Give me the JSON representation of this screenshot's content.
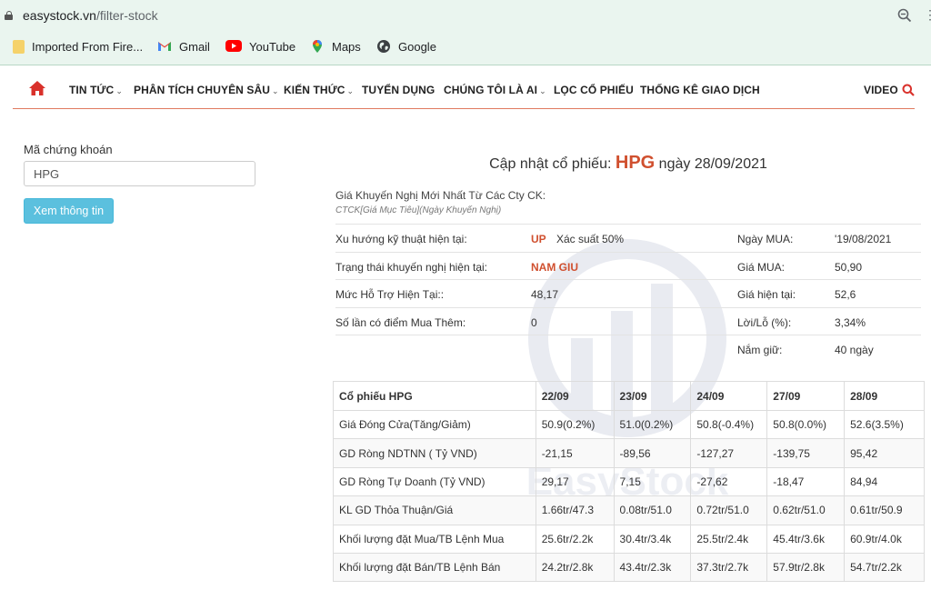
{
  "browser": {
    "url_host": "easystock.vn",
    "url_path": "/filter-stock",
    "bookmarks": [
      {
        "label": "Imported From Fire...",
        "icon": "folder-icon"
      },
      {
        "label": "Gmail",
        "icon": "gmail-icon"
      },
      {
        "label": "YouTube",
        "icon": "youtube-icon"
      },
      {
        "label": "Maps",
        "icon": "maps-icon"
      },
      {
        "label": "Google",
        "icon": "google-globe-icon"
      }
    ]
  },
  "nav": {
    "items": [
      {
        "label": "TIN TỨC",
        "dropdown": true
      },
      {
        "label": "PHÂN TÍCH CHUYÊN SÂU",
        "dropdown": true
      },
      {
        "label": "KIẾN THỨC",
        "dropdown": true
      },
      {
        "label": "TUYỂN DỤNG",
        "dropdown": false
      },
      {
        "label": "CHÚNG TÔI LÀ AI",
        "dropdown": true
      },
      {
        "label": "LỌC CỔ PHIẾU",
        "dropdown": false
      },
      {
        "label": "THỐNG KÊ GIAO DỊCH",
        "dropdown": false
      },
      {
        "label": "VIDEO",
        "dropdown": false
      }
    ],
    "chevron": "⌄"
  },
  "form": {
    "label": "Mã chứng khoán",
    "input_value": "HPG",
    "button_label": "Xem thông tin"
  },
  "title": {
    "prefix": "Cập nhật cổ phiếu:",
    "symbol": "HPG",
    "suffix": "ngày 28/09/2021"
  },
  "recommend": {
    "heading": "Giá Khuyến Nghị Mới Nhất Từ Các Cty CK:",
    "subheading": "CTCK[Giá Mục Tiêu](Ngày Khuyến Nghị)"
  },
  "info": {
    "rows": [
      {
        "label": "Xu hướng kỹ thuật hiện tại:",
        "value": "UP",
        "extra": "Xác suất 50%",
        "right_label": "Ngày MUA:",
        "right_value": "'19/08/2021"
      },
      {
        "label": "Trạng thái khuyến nghị hiện tại:",
        "value": "NAM GIU",
        "extra": "",
        "right_label": "Giá MUA:",
        "right_value": "50,90"
      },
      {
        "label": "Mức Hỗ Trợ Hiện Tại::",
        "value": "48,17",
        "extra": "",
        "right_label": "Giá hiện tại:",
        "right_value": "52,6"
      },
      {
        "label": "Số lần có điểm Mua Thêm:",
        "value": "0",
        "extra": "",
        "right_label": "Lời/Lỗ (%):",
        "right_value": "3,34%"
      },
      {
        "label": "",
        "value": "",
        "extra": "",
        "right_label": "Nắm giữ:",
        "right_value": "40 ngày"
      }
    ]
  },
  "table": {
    "headers": [
      "Cổ phiếu HPG",
      "22/09",
      "23/09",
      "24/09",
      "27/09",
      "28/09"
    ],
    "rows": [
      [
        "Giá Đóng Cửa(Tăng/Giảm)",
        "50.9(0.2%)",
        "51.0(0.2%)",
        "50.8(-0.4%)",
        "50.8(0.0%)",
        "52.6(3.5%)"
      ],
      [
        "GD Ròng NDTNN ( Tỷ VND)",
        "-21,15",
        "-89,56",
        "-127,27",
        "-139,75",
        "95,42"
      ],
      [
        "GD Ròng Tự Doanh (Tỷ VND)",
        "29,17",
        "7,15",
        "-27,62",
        "-18,47",
        "84,94"
      ],
      [
        "KL GD Thỏa Thuận/Giá",
        "1.66tr/47.3",
        "0.08tr/51.0",
        "0.72tr/51.0",
        "0.62tr/51.0",
        "0.61tr/50.9"
      ],
      [
        "Khối lượng đặt Mua/TB Lệnh Mua",
        "25.6tr/2.2k",
        "30.4tr/3.4k",
        "25.5tr/2.4k",
        "45.4tr/3.6k",
        "60.9tr/4.0k"
      ],
      [
        "Khối lượng đặt Bán/TB Lệnh Bán",
        "24.2tr/2.8k",
        "43.4tr/2.3k",
        "37.3tr/2.7k",
        "57.9tr/2.8k",
        "54.7tr/2.2k"
      ]
    ]
  },
  "watermark_text": "EasyStock",
  "colors": {
    "accent": "#d0502f",
    "button": "#5bc0de",
    "chrome": "#eaf5ef"
  }
}
